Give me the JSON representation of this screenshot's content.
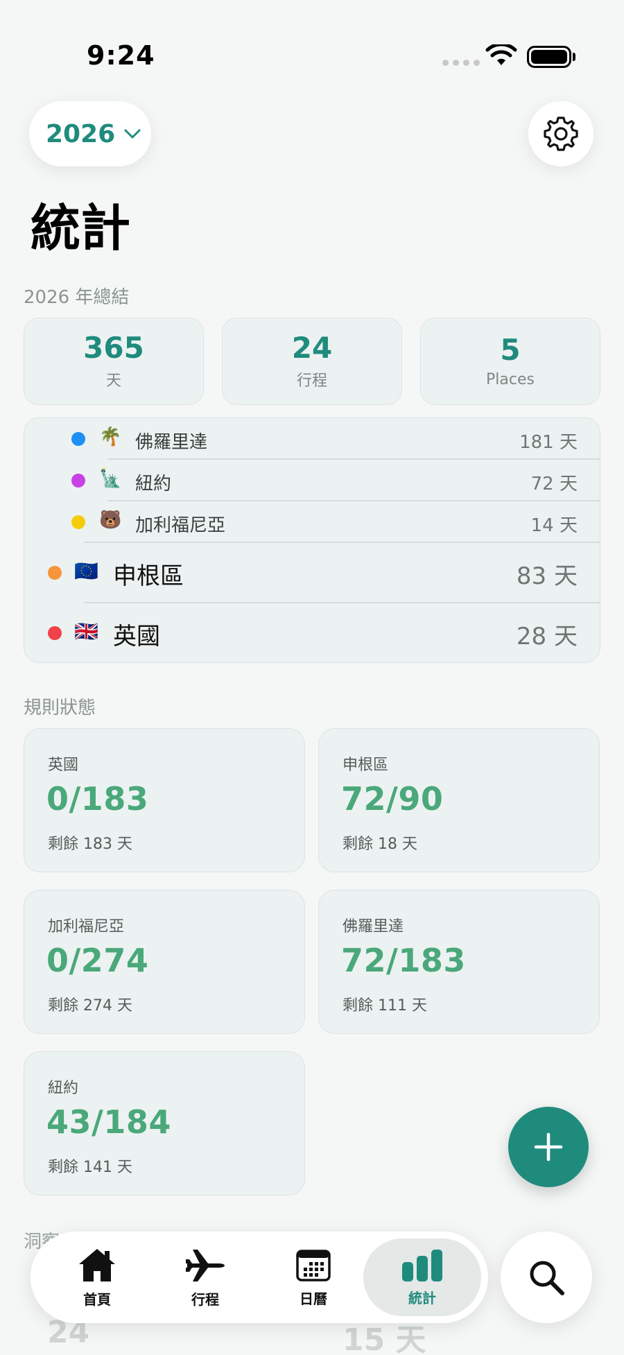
{
  "status_bar": {
    "time": "9:24"
  },
  "header": {
    "year": "2026",
    "title": "統計"
  },
  "summary": {
    "section_label": "2026 年總結",
    "cards": [
      {
        "value": "365",
        "label": "天"
      },
      {
        "value": "24",
        "label": "行程"
      },
      {
        "value": "5",
        "label": "Places"
      }
    ]
  },
  "places": [
    {
      "name": "佛羅里達",
      "days": "181 天",
      "color": "#1e8ff5",
      "emoji": "🌴"
    },
    {
      "name": "紐約",
      "days": "72 天",
      "color": "#c940e6",
      "emoji": "🗽"
    },
    {
      "name": "加利福尼亞",
      "days": "14 天",
      "color": "#f5cc0a",
      "emoji": "🐻"
    },
    {
      "name": "申根區",
      "days": "83 天",
      "color": "#f7953a",
      "emoji": "🇪🇺"
    },
    {
      "name": "英國",
      "days": "28 天",
      "color": "#f0424a",
      "emoji": "🇬🇧"
    }
  ],
  "rules": {
    "section_label": "規則狀態",
    "cards": [
      {
        "name": "英國",
        "value": "0/183",
        "remaining": "剩餘 183 天"
      },
      {
        "name": "申根區",
        "value": "72/90",
        "remaining": "剩餘 18 天"
      },
      {
        "name": "加利福尼亞",
        "value": "0/274",
        "remaining": "剩餘 274 天"
      },
      {
        "name": "佛羅里達",
        "value": "72/183",
        "remaining": "剩餘 111 天"
      },
      {
        "name": "紐約",
        "value": "43/184",
        "remaining": "剩餘 141 天"
      }
    ]
  },
  "insights": {
    "section_label": "洞察",
    "peek_values": [
      "24",
      "15 天"
    ]
  },
  "tabs": [
    {
      "label": "首頁",
      "icon": "house-icon"
    },
    {
      "label": "行程",
      "icon": "airplane-icon"
    },
    {
      "label": "日曆",
      "icon": "calendar-icon"
    },
    {
      "label": "統計",
      "icon": "chart-bar-icon",
      "active": true
    }
  ],
  "colors": {
    "accent": "#1f8b7d",
    "rule_value": "#4aa87a"
  }
}
